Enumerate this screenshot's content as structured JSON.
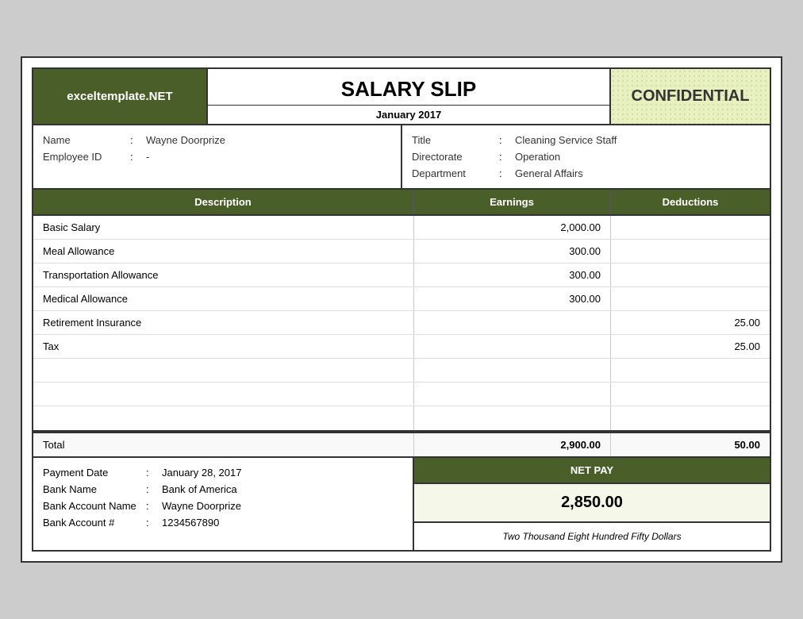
{
  "header": {
    "logo": "exceltemplate.NET",
    "title": "SALARY SLIP",
    "subtitle": "January 2017",
    "confidential": "CONFIDENTIAL"
  },
  "employee": {
    "left": [
      {
        "label": "Name",
        "colon": ":",
        "value": "Wayne Doorprize"
      },
      {
        "label": "Employee ID",
        "colon": ":",
        "value": "-"
      }
    ],
    "right": [
      {
        "label": "Title",
        "colon": ":",
        "value": "Cleaning Service Staff"
      },
      {
        "label": "Directorate",
        "colon": ":",
        "value": "Operation"
      },
      {
        "label": "Department",
        "colon": ":",
        "value": "General Affairs"
      }
    ]
  },
  "table": {
    "headers": {
      "description": "Description",
      "earnings": "Earnings",
      "deductions": "Deductions"
    },
    "rows": [
      {
        "description": "Basic Salary",
        "earnings": "2,000.00",
        "deductions": ""
      },
      {
        "description": "Meal Allowance",
        "earnings": "300.00",
        "deductions": ""
      },
      {
        "description": "Transportation Allowance",
        "earnings": "300.00",
        "deductions": ""
      },
      {
        "description": "Medical Allowance",
        "earnings": "300.00",
        "deductions": ""
      },
      {
        "description": "Retirement Insurance",
        "earnings": "",
        "deductions": "25.00"
      },
      {
        "description": "Tax",
        "earnings": "",
        "deductions": "25.00"
      },
      {
        "description": "",
        "earnings": "",
        "deductions": ""
      },
      {
        "description": "",
        "earnings": "",
        "deductions": ""
      },
      {
        "description": "",
        "earnings": "",
        "deductions": ""
      }
    ],
    "total": {
      "label": "Total",
      "earnings": "2,900.00",
      "deductions": "50.00"
    }
  },
  "payment": {
    "rows": [
      {
        "label": "Payment Date",
        "colon": ":",
        "value": "January 28, 2017"
      },
      {
        "label": "Bank Name",
        "colon": ":",
        "value": "Bank of America"
      },
      {
        "label": "Bank Account Name",
        "colon": ":",
        "value": "Wayne Doorprize"
      },
      {
        "label": "Bank Account #",
        "colon": ":",
        "value": "1234567890"
      }
    ]
  },
  "netpay": {
    "header": "NET PAY",
    "amount": "2,850.00",
    "words": "Two Thousand Eight Hundred Fifty Dollars"
  }
}
